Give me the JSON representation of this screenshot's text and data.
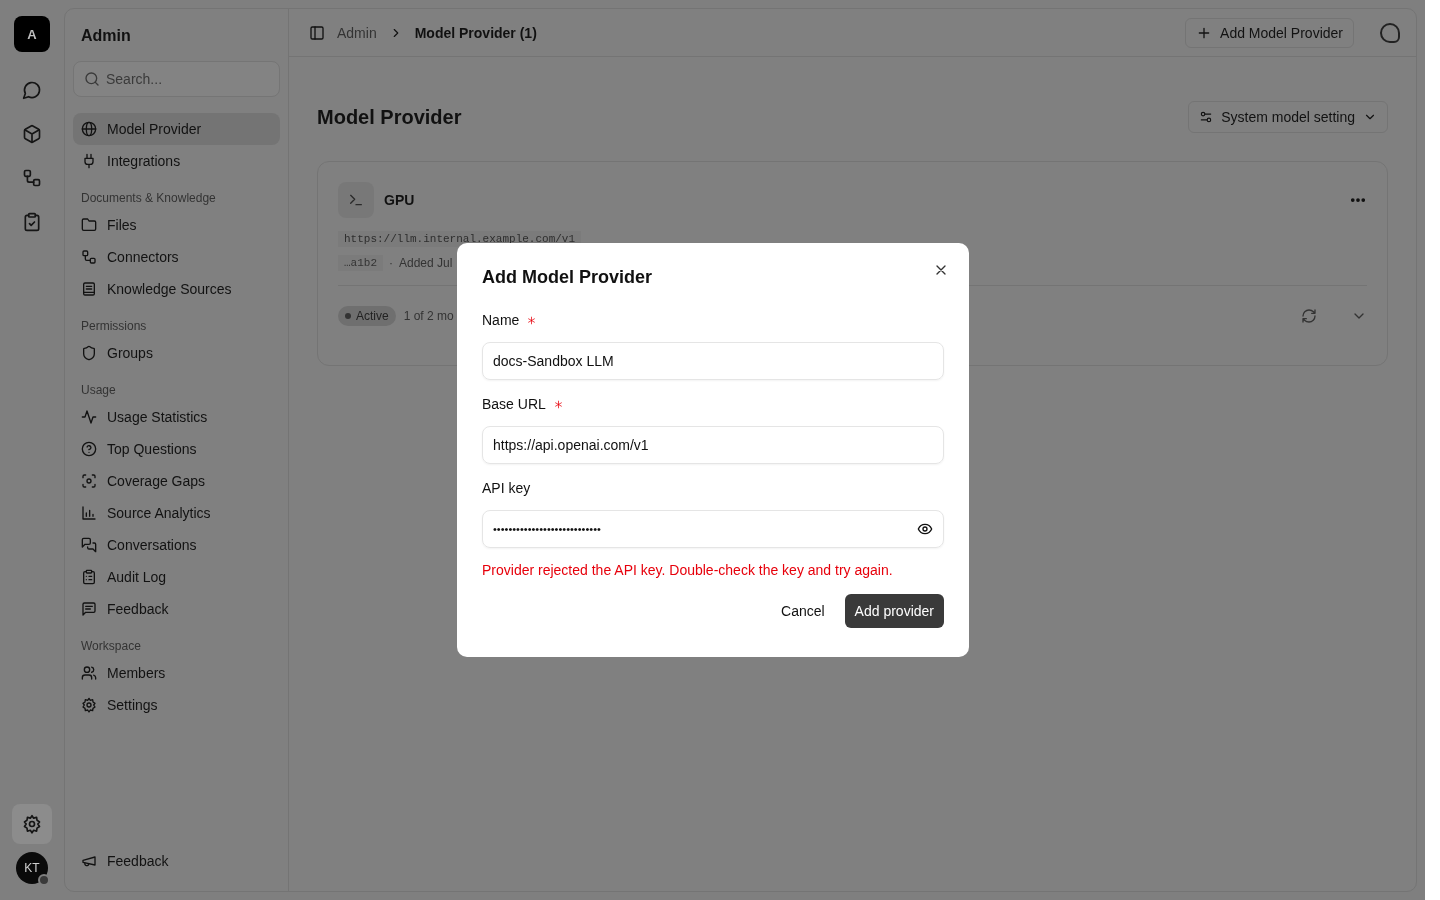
{
  "rail": {
    "logo": "A",
    "items": [
      {
        "selected": false
      },
      {
        "selected": false
      },
      {
        "selected": false
      },
      {
        "selected": false
      }
    ],
    "settings": {
      "selected": true
    },
    "avatar": {
      "initials": "KT",
      "online": true
    }
  },
  "sidebar": {
    "title": "Admin",
    "search": {
      "placeholder": "Search..."
    },
    "groups": [
      {
        "items": [
          {
            "label": "Model Provider",
            "selected": true
          },
          {
            "label": "Integrations",
            "selected": false
          }
        ]
      },
      {
        "heading": "Documents & Knowledge",
        "items": [
          {
            "label": "Files",
            "selected": false
          },
          {
            "label": "Connectors",
            "selected": false
          },
          {
            "label": "Knowledge Sources",
            "selected": false
          }
        ]
      },
      {
        "heading": "Permissions",
        "items": [
          {
            "label": "Groups",
            "selected": false
          }
        ]
      },
      {
        "heading": "Usage",
        "items": [
          {
            "label": "Usage Statistics",
            "selected": false
          },
          {
            "label": "Top Questions",
            "selected": false
          },
          {
            "label": "Coverage Gaps",
            "selected": false
          },
          {
            "label": "Source Analytics",
            "selected": false
          },
          {
            "label": "Conversations",
            "selected": false
          },
          {
            "label": "Audit Log",
            "selected": false
          },
          {
            "label": "Feedback",
            "selected": false
          }
        ]
      },
      {
        "heading": "Workspace",
        "items": [
          {
            "label": "Members",
            "selected": false
          },
          {
            "label": "Settings",
            "selected": false
          }
        ]
      }
    ],
    "footer": {
      "label": "Feedback"
    }
  },
  "header": {
    "breadcrumb": [
      "Admin",
      "Model Provider (1)"
    ],
    "add_button": "Add Model Provider"
  },
  "page": {
    "title": "Model Provider",
    "settings_button": "System model setting",
    "providers": [
      {
        "name": "GPU",
        "url": "https://llm.internal.example.com/v1",
        "key": "…a1b2",
        "separator": "·",
        "added": "Added Jul",
        "status": "Active",
        "models": "1 of 2 mo"
      }
    ]
  },
  "dialog": {
    "title": "Add Model Provider",
    "fields": [
      {
        "label": "Name",
        "required": true,
        "kind": "text",
        "value": "docs-Sandbox LLM"
      },
      {
        "label": "Base URL",
        "required": true,
        "kind": "text",
        "value": "https://api.openai.com/v1"
      },
      {
        "label": "API key",
        "required": false,
        "kind": "secret",
        "value": "••••••••••••••••••••••••••••"
      }
    ],
    "error": "Provider rejected the API key. Double-check the key and try again.",
    "cancel": "Cancel",
    "submit": "Add provider"
  }
}
